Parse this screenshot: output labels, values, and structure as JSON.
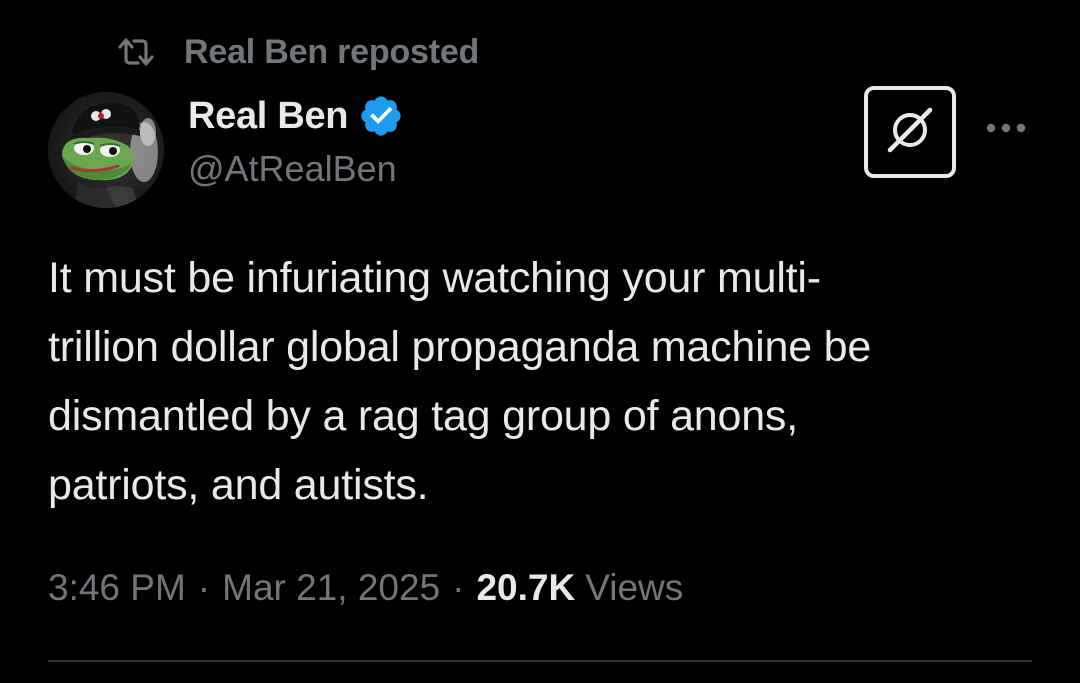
{
  "repost": {
    "label": "Real Ben reposted",
    "icon": "repost-icon"
  },
  "author": {
    "display_name": "Real Ben",
    "handle": "@AtRealBen",
    "verified": true,
    "verified_color": "#1d9bf0",
    "avatar_icon": "frog-avatar"
  },
  "actions": {
    "grok_icon": "grok-icon",
    "more_icon": "more-options-icon"
  },
  "tweet": {
    "text": "It must be infuriating watching your multi-\ntrillion dollar global propaganda machine be\ndismantled by a rag tag group of anons,\npatriots, and autists."
  },
  "meta": {
    "time": "3:46 PM",
    "separator": "·",
    "date": "Mar 21, 2025",
    "views_count": "20.7K",
    "views_label": "Views"
  },
  "colors": {
    "background": "#000000",
    "primary_text": "#e7e9ea",
    "secondary_text": "#71767b",
    "divider": "#2f3336"
  }
}
